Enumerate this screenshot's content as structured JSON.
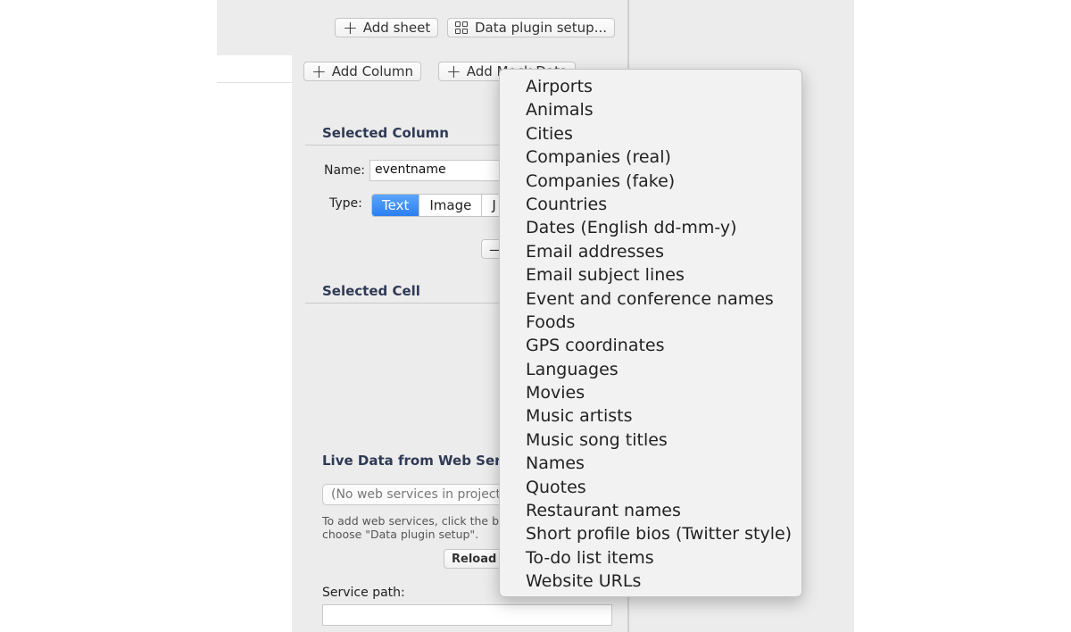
{
  "toolbar": {
    "add_sheet": "Add sheet",
    "data_plugin_setup": "Data plugin setup..."
  },
  "inspector": {
    "add_column": "Add Column",
    "add_mock_data": "Add Mock Data",
    "selected_column": {
      "heading": "Selected Column",
      "name_label": "Name:",
      "name_value": "eventname",
      "type_label": "Type:",
      "types": [
        "Text",
        "Image",
        "J"
      ],
      "active_type": "Text"
    },
    "selected_cell": {
      "heading": "Selected Cell"
    },
    "live_data": {
      "heading": "Live Data from Web Servic",
      "popup_value": "(No web services in project)",
      "help_line1": "To add web services, click the bu",
      "help_line2": "choose \"Data plugin setup\".",
      "reload_button": "Reload",
      "service_path_label": "Service path:",
      "service_path_value": ""
    }
  },
  "mock_data_menu": {
    "items": [
      "Airports",
      "Animals",
      "Cities",
      "Companies (real)",
      "Companies (fake)",
      "Countries",
      "Dates (English dd-mm-y)",
      "Email addresses",
      "Email subject lines",
      "Event and conference names",
      "Foods",
      "GPS coordinates",
      "Languages",
      "Movies",
      "Music artists",
      "Music song titles",
      "Names",
      "Quotes",
      "Restaurant names",
      "Short profile bios (Twitter style)",
      "To-do list items",
      "Website URLs"
    ]
  },
  "colors": {
    "accent_blue": "#2b7ff0",
    "section_heading": "#2f3a55",
    "window_bg": "#ececec"
  }
}
